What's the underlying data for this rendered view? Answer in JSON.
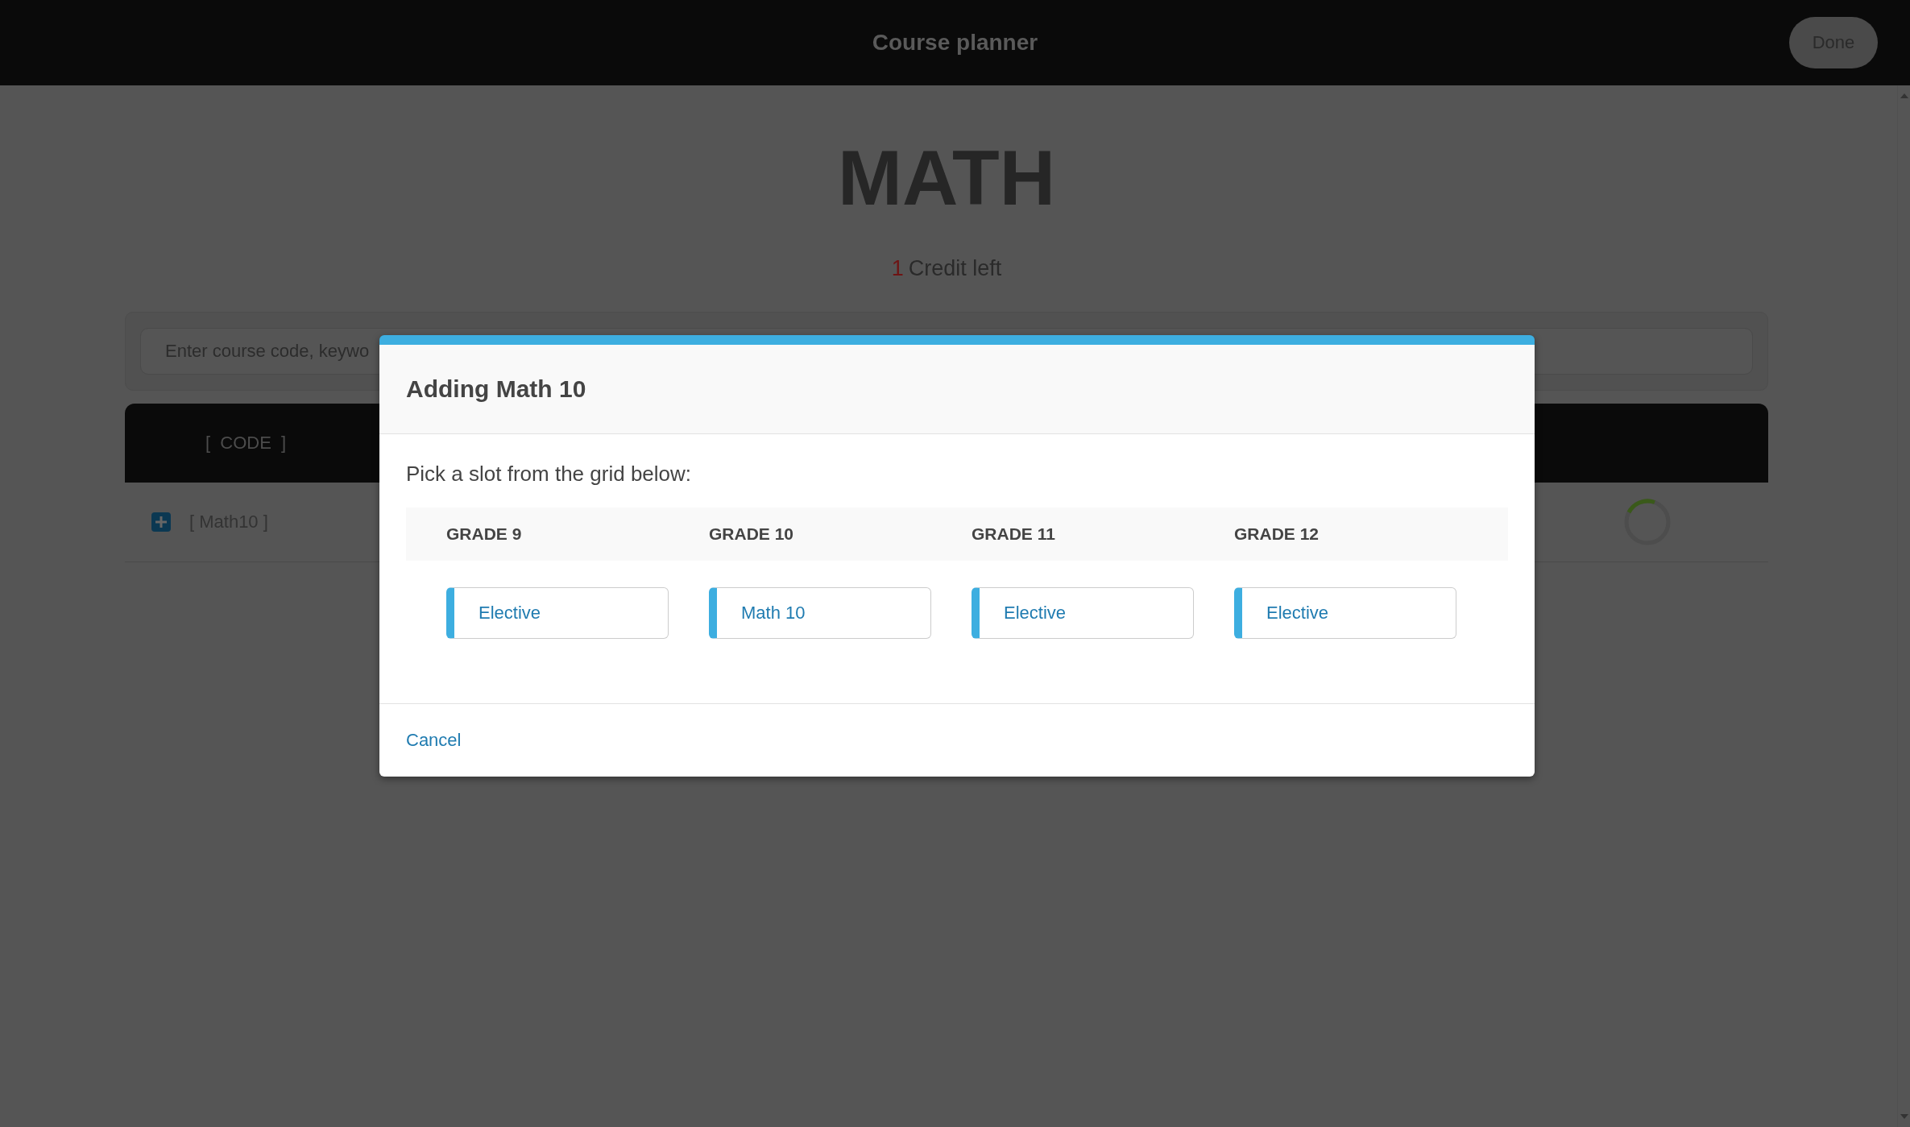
{
  "header": {
    "title": "Course planner",
    "done_button": "Done"
  },
  "subject": {
    "title": "MATH",
    "credits_count": "1",
    "credits_label": "Credit left"
  },
  "search": {
    "placeholder": "Enter course code, keywo"
  },
  "table": {
    "columns": [
      "[  CODE  ]"
    ],
    "rows": [
      {
        "code": "[ Math10 ]",
        "expanded": false,
        "loading": true
      }
    ]
  },
  "modal": {
    "title": "Adding Math 10",
    "prompt": "Pick a slot from the grid below:",
    "grades": [
      {
        "label": "GRADE 9",
        "slot": "Elective"
      },
      {
        "label": "GRADE 10",
        "slot": "Math 10"
      },
      {
        "label": "GRADE 11",
        "slot": "Elective"
      },
      {
        "label": "GRADE 12",
        "slot": "Elective"
      }
    ],
    "cancel": "Cancel"
  }
}
